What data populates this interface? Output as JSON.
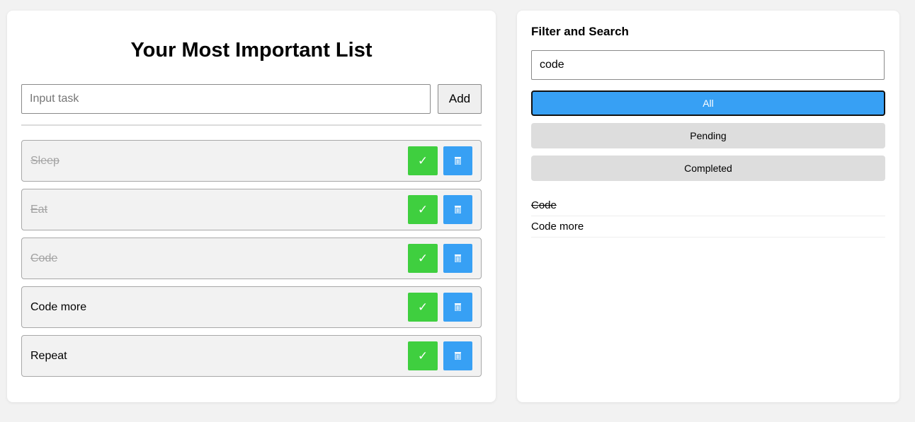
{
  "todo": {
    "title": "Your Most Important List",
    "input_placeholder": "Input task",
    "add_label": "Add",
    "complete_label": "✓",
    "tasks": [
      {
        "text": "Sleep",
        "completed": true
      },
      {
        "text": "Eat",
        "completed": true
      },
      {
        "text": "Code",
        "completed": true
      },
      {
        "text": "Code more",
        "completed": false
      },
      {
        "text": "Repeat",
        "completed": false
      }
    ]
  },
  "filter": {
    "title": "Filter and Search",
    "search_value": "code",
    "buttons": {
      "all": "All",
      "pending": "Pending",
      "completed": "Completed"
    },
    "active": "all",
    "results": [
      {
        "text": "Code",
        "completed": true
      },
      {
        "text": "Code more",
        "completed": false
      }
    ]
  },
  "colors": {
    "complete_button": "#3fcf3f",
    "delete_button": "#37a0f4",
    "active_filter": "#37a0f4"
  },
  "icons": {
    "complete": "check-icon",
    "delete": "trash-icon"
  }
}
